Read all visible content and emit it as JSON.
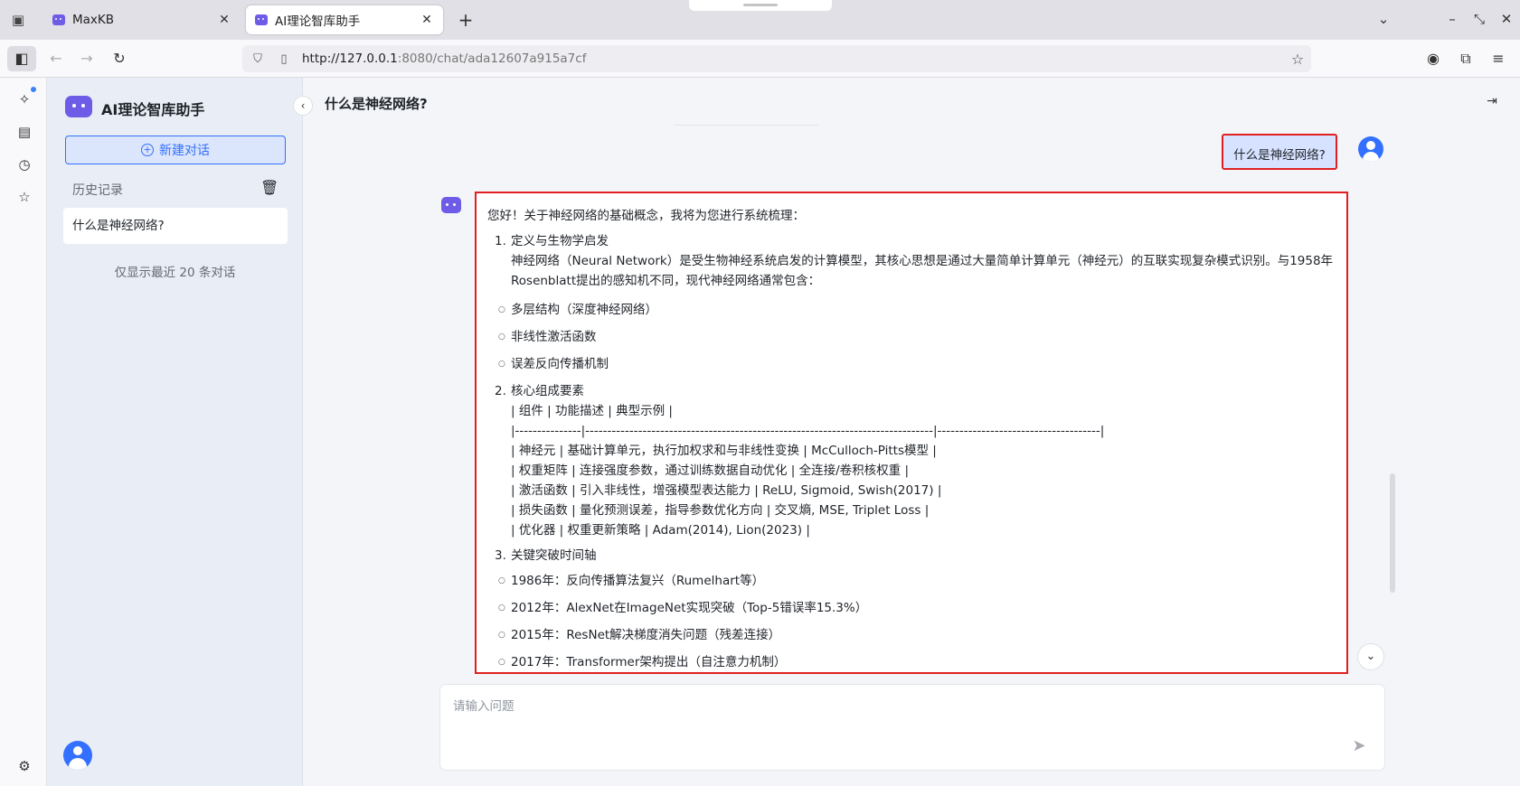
{
  "browser": {
    "tabs": [
      {
        "title": "MaxKB"
      },
      {
        "title": "AI理论智库助手"
      }
    ],
    "url": {
      "host": "http://127.0.0.1",
      "rest": ":8080/chat/ada12607a915a7cf"
    }
  },
  "app": {
    "title": "AI理论智库助手",
    "new_chat_label": "新建对话",
    "history_label": "历史记录",
    "history_items": [
      "什么是神经网络?"
    ],
    "history_note": "仅显示最近 20 条对话"
  },
  "chat": {
    "title": "什么是神经网络?",
    "question": "什么是神经网络?",
    "input_placeholder": "请输入问题",
    "answer": {
      "intro": "您好！关于神经网络的基础概念，我将为您进行系统梳理：",
      "sections": [
        {
          "num": "1.",
          "title": "定义与生物学启发",
          "desc": "神经网络（Neural Network）是受生物神经系统启发的计算模型，其核心思想是通过大量简单计算单元（神经元）的互联实现复杂模式识别。与1958年Rosenblatt提出的感知机不同，现代神经网络通常包含：",
          "bullets": [
            "多层结构（深度神经网络）",
            "非线性激活函数",
            "误差反向传播机制"
          ]
        },
        {
          "num": "2.",
          "title": "核心组成要素",
          "table_lines": [
            "| 组件 | 功能描述 | 典型示例 |",
            "|---------------|-------------------------------------------------------------------------------|-------------------------------------|",
            "| 神经元 | 基础计算单元，执行加权求和与非线性变换 | McCulloch-Pitts模型 |",
            "| 权重矩阵 | 连接强度参数，通过训练数据自动优化 | 全连接/卷积核权重 |",
            "| 激活函数 | 引入非线性，增强模型表达能力 | ReLU, Sigmoid, Swish(2017) |",
            "| 损失函数 | 量化预测误差，指导参数优化方向 | 交叉熵, MSE, Triplet Loss |",
            "| 优化器 | 权重更新策略 | Adam(2014), Lion(2023) |"
          ]
        },
        {
          "num": "3.",
          "title": "关键突破时间轴",
          "bullets": [
            "1986年：反向传播算法复兴（Rumelhart等）",
            "2012年：AlexNet在ImageNet实现突破（Top-5错误率15.3%）",
            "2015年：ResNet解决梯度消失问题（残差连接）",
            "2017年：Transformer架构提出（自注意力机制）"
          ]
        }
      ]
    }
  },
  "colors": {
    "accent": "#3370ff",
    "bot": "#6e5ce7",
    "highlight_border": "#e02020"
  }
}
